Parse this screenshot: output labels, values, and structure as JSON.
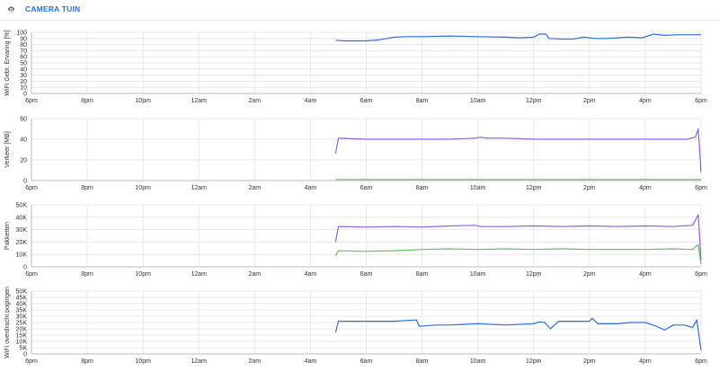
{
  "header": {
    "title": "CAMERA TUIN",
    "icon": "camera-icon"
  },
  "colors": {
    "blue": "#2f6fe0",
    "purple": "#8f5fe8",
    "green": "#5fc25f",
    "grid": "#e4e4e4",
    "axis": "#bdbdbd",
    "title": "#1f6feb"
  },
  "x_ticks": [
    "6pm",
    "8pm",
    "10pm",
    "12am",
    "2am",
    "4am",
    "6am",
    "8am",
    "10am",
    "12pm",
    "2pm",
    "4pm",
    "6pm"
  ],
  "charts": [
    {
      "id": "wifi-experience",
      "ylabel": "WiFi Gebr. Ervaring [%]",
      "yticks": [
        "0",
        "10",
        "20",
        "30",
        "40",
        "50",
        "60",
        "70",
        "80",
        "90",
        "100"
      ],
      "ymax": 100,
      "series": [
        {
          "color": "blue",
          "data": [
            [
              10.9,
              87
            ],
            [
              11.2,
              86
            ],
            [
              12,
              86
            ],
            [
              12.5,
              88
            ],
            [
              13.0,
              92
            ],
            [
              13.5,
              93
            ],
            [
              14,
              93
            ],
            [
              15,
              94
            ],
            [
              16,
              93
            ],
            [
              17,
              92
            ],
            [
              17.5,
              91
            ],
            [
              18.0,
              92
            ],
            [
              18.2,
              97
            ],
            [
              18.45,
              97
            ],
            [
              18.55,
              90
            ],
            [
              19,
              89
            ],
            [
              19.4,
              89
            ],
            [
              19.8,
              92
            ],
            [
              20.2,
              90
            ],
            [
              20.6,
              90
            ],
            [
              21,
              91
            ],
            [
              21.4,
              92
            ],
            [
              21.9,
              91
            ],
            [
              22.3,
              97
            ],
            [
              22.7,
              95
            ],
            [
              23.2,
              96
            ],
            [
              24,
              96
            ]
          ]
        }
      ]
    },
    {
      "id": "traffic",
      "ylabel": "Verkeer [MB]",
      "yticks": [
        "0",
        "20",
        "40",
        "60"
      ],
      "ymax": 60,
      "series": [
        {
          "color": "purple",
          "data": [
            [
              10.9,
              26
            ],
            [
              11.0,
              41
            ],
            [
              12,
              40
            ],
            [
              13,
              40
            ],
            [
              14,
              40
            ],
            [
              15,
              40
            ],
            [
              15.9,
              41
            ],
            [
              16.1,
              42
            ],
            [
              16.3,
              41
            ],
            [
              17,
              41
            ],
            [
              18,
              40
            ],
            [
              19,
              40
            ],
            [
              20,
              40
            ],
            [
              21,
              40
            ],
            [
              22,
              40
            ],
            [
              22.5,
              40
            ],
            [
              23.0,
              40
            ],
            [
              23.5,
              40
            ],
            [
              23.8,
              42
            ],
            [
              23.9,
              50
            ],
            [
              24,
              8
            ]
          ]
        },
        {
          "color": "green",
          "data": [
            [
              10.9,
              1
            ],
            [
              24,
              1
            ]
          ]
        }
      ]
    },
    {
      "id": "packets",
      "ylabel": "Pakketten",
      "yticks": [
        "0",
        "10K",
        "20K",
        "30K",
        "40K",
        "50K"
      ],
      "ymax": 50000,
      "series": [
        {
          "color": "purple",
          "data": [
            [
              10.9,
              20000
            ],
            [
              11.0,
              32500
            ],
            [
              12,
              32000
            ],
            [
              13,
              32500
            ],
            [
              14,
              32000
            ],
            [
              15,
              33000
            ],
            [
              15.9,
              33500
            ],
            [
              16.1,
              32500
            ],
            [
              17,
              32500
            ],
            [
              18,
              33000
            ],
            [
              19,
              32500
            ],
            [
              20,
              33000
            ],
            [
              21,
              32500
            ],
            [
              22,
              33000
            ],
            [
              23,
              32500
            ],
            [
              23.7,
              33500
            ],
            [
              23.9,
              42000
            ],
            [
              24,
              5000
            ]
          ]
        },
        {
          "color": "green",
          "data": [
            [
              10.9,
              9000
            ],
            [
              11.0,
              13000
            ],
            [
              12,
              12500
            ],
            [
              13,
              13000
            ],
            [
              14,
              14000
            ],
            [
              15,
              14500
            ],
            [
              16,
              14000
            ],
            [
              17,
              14500
            ],
            [
              18,
              14000
            ],
            [
              19,
              14500
            ],
            [
              20,
              14000
            ],
            [
              21,
              14000
            ],
            [
              22,
              14000
            ],
            [
              23,
              14500
            ],
            [
              23.7,
              14000
            ],
            [
              23.9,
              18000
            ],
            [
              24,
              2000
            ]
          ]
        }
      ]
    },
    {
      "id": "wifi-retries",
      "ylabel": "WiFi overdracht pogingen",
      "yticks": [
        "0",
        "5K",
        "10K",
        "15K",
        "20K",
        "25K",
        "30K",
        "35K",
        "40K",
        "45K",
        "50K"
      ],
      "ymax": 50000,
      "series": [
        {
          "color": "blue",
          "data": [
            [
              10.9,
              17000
            ],
            [
              11.0,
              26000
            ],
            [
              12,
              26000
            ],
            [
              13,
              26000
            ],
            [
              13.8,
              27000
            ],
            [
              13.9,
              22000
            ],
            [
              14.5,
              23000
            ],
            [
              15,
              23000
            ],
            [
              16,
              24000
            ],
            [
              17,
              23000
            ],
            [
              18,
              24000
            ],
            [
              18.2,
              25500
            ],
            [
              18.4,
              25000
            ],
            [
              18.6,
              20000
            ],
            [
              18.9,
              26000
            ],
            [
              19.5,
              26000
            ],
            [
              20,
              26000
            ],
            [
              20.1,
              28500
            ],
            [
              20.3,
              24000
            ],
            [
              21,
              24000
            ],
            [
              21.5,
              25000
            ],
            [
              22,
              25000
            ],
            [
              22.4,
              22000
            ],
            [
              22.7,
              19000
            ],
            [
              23,
              23000
            ],
            [
              23.4,
              23000
            ],
            [
              23.7,
              21000
            ],
            [
              23.85,
              27000
            ],
            [
              24,
              3000
            ]
          ]
        }
      ]
    }
  ]
}
